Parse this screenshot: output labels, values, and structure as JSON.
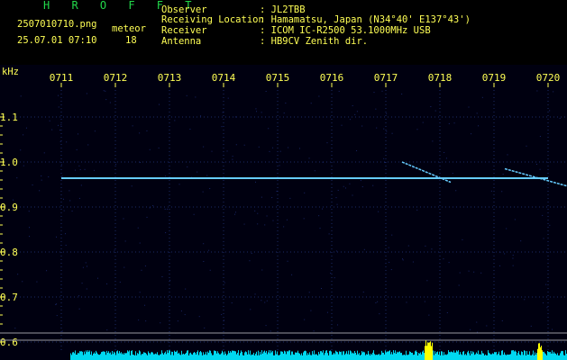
{
  "header": {
    "brand": "H R O F F T",
    "filename": "2507010710.png",
    "timestamp": "25.07.01 07:10",
    "meteor_label": "meteor",
    "meteor_count": "18",
    "info": [
      {
        "key": "Observer",
        "value": ": JL2TBB"
      },
      {
        "key": "Receiving Location",
        "value": ": Hamamatsu, Japan (N34°40' E137°43')"
      },
      {
        "key": "Receiver",
        "value": ": ICOM IC-R2500 53.1000MHz USB"
      },
      {
        "key": "Antenna",
        "value": ": HB9CV Zenith dir."
      }
    ]
  },
  "y_axis_unit": "kHz",
  "colors": {
    "background": "#000010",
    "text": "#ffff55",
    "brand": "#22d84a",
    "signal": "#66ccff",
    "baseline_fill": "#00d8f0",
    "baseline_peak": "#ffff00"
  },
  "chart_data": {
    "type": "scatter",
    "title": "",
    "x_ticks": [
      "0711",
      "0712",
      "0713",
      "0714",
      "0715",
      "0716",
      "0717",
      "0718",
      "0719",
      "0720"
    ],
    "y_ticks": [
      "1.1",
      "1.0",
      "0.9",
      "0.8",
      "0.7",
      "0.6"
    ],
    "ylim": [
      0.6,
      1.1
    ],
    "xlim": [
      "07:10",
      "07:20"
    ],
    "series": [
      {
        "points": [
          {
            "x": "07:11",
            "y": 0.964
          },
          {
            "x": "07:20",
            "y": 0.964
          }
        ]
      }
    ],
    "meteor_traces": [
      [
        {
          "x": "07:17.3",
          "y": 1.0
        },
        {
          "x": "07:18.2",
          "y": 0.955
        }
      ],
      [
        {
          "x": "07:19.2",
          "y": 0.985
        },
        {
          "x": "07:20.4",
          "y": 0.945
        }
      ]
    ]
  }
}
